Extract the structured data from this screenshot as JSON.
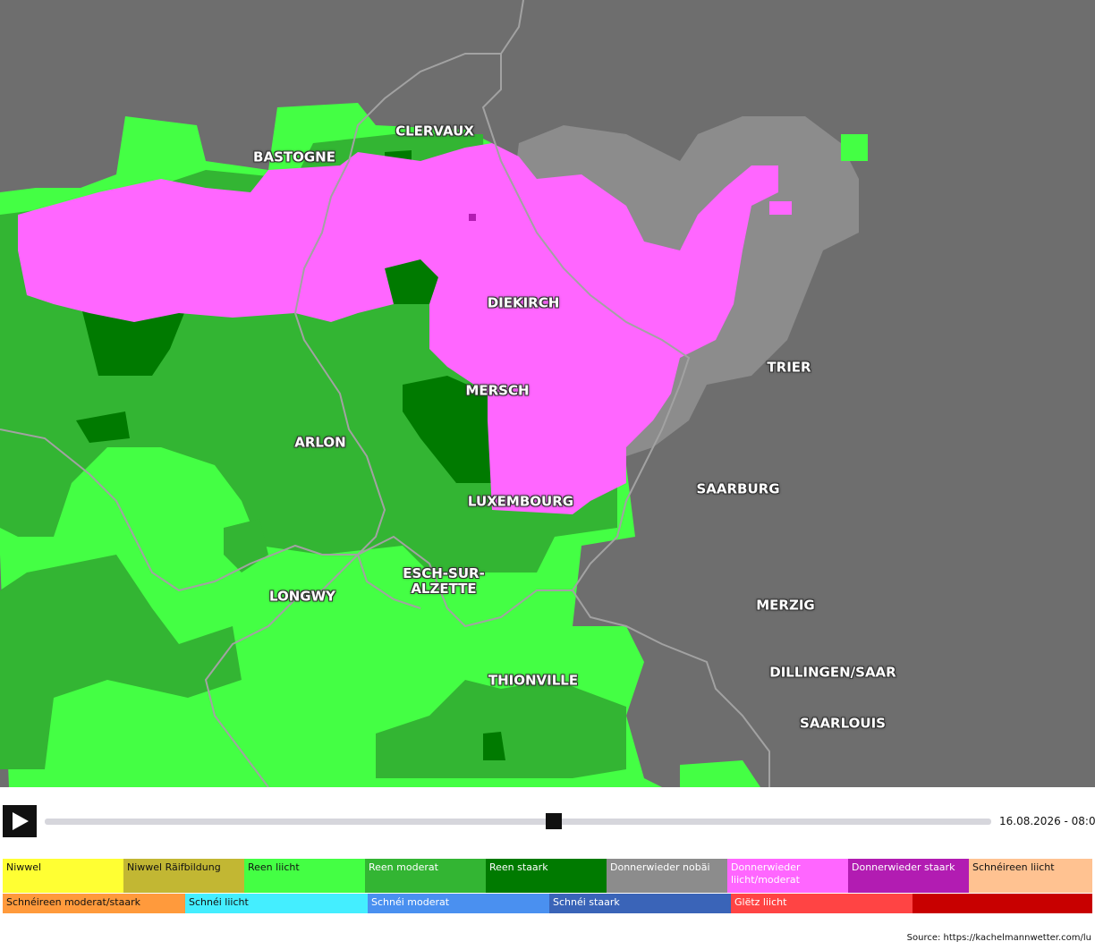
{
  "map": {
    "cities": [
      {
        "name": "BASTOGNE"
      },
      {
        "name": "CLERVAUX"
      },
      {
        "name": "DIEKIRCH"
      },
      {
        "name": "TRIER"
      },
      {
        "name": "MERSCH"
      },
      {
        "name": "ARLON"
      },
      {
        "name": "SAARBURG"
      },
      {
        "name": "LUXEMBOURG"
      },
      {
        "name": "ESCH-SUR-\nALZETTE"
      },
      {
        "name": "LONGWY"
      },
      {
        "name": "MERZIG"
      },
      {
        "name": "DILLINGEN/SAAR"
      },
      {
        "name": "THIONVILLE"
      },
      {
        "name": "SAARLOUIS"
      }
    ],
    "colors": {
      "background": "#6e6e6e",
      "border": "#9a9a9a",
      "rain_light": "#44ff44",
      "rain_moderate": "#33b533",
      "rain_heavy": "#007a00",
      "thunder_possible": "#8c8c8c",
      "thunder_light_moderate": "#ff66ff",
      "thunder_heavy": "#b21cb2"
    }
  },
  "player": {
    "play_icon": "play-icon",
    "timestamp": "16.08.2026 - 08:00",
    "progress": 0.538
  },
  "legend": {
    "row1": [
      {
        "label": "Niwwel",
        "color": "#ffff33"
      },
      {
        "label": "Niwwel Räifbildung",
        "color": "#c2b733"
      },
      {
        "label": "Reen liicht",
        "color": "#44ff44"
      },
      {
        "label": "Reen moderat",
        "color": "#33b533"
      },
      {
        "label": "Reen staark",
        "color": "#007a00"
      },
      {
        "label": "Donnerwieder nobäi",
        "color": "#8c8c8c"
      },
      {
        "label": "Donnerwieder liicht/moderat",
        "color": "#ff66ff"
      },
      {
        "label": "Donnerwieder staark",
        "color": "#b21cb2"
      },
      {
        "label": "Schnéireen liicht",
        "color": "#ffc291"
      }
    ],
    "row2": [
      {
        "label": "Schnéireen moderat/staark",
        "color": "#ff9a3c"
      },
      {
        "label": "Schnéi liicht",
        "color": "#44eeff"
      },
      {
        "label": "Schnéi moderat",
        "color": "#4a90f0"
      },
      {
        "label": "Schnéi staark",
        "color": "#3a64b8"
      },
      {
        "label": "Glëtz liicht",
        "color": "#ff4444"
      },
      {
        "label": "",
        "color": "#c80000"
      }
    ]
  },
  "source": "Source: https://kachelmannwetter.com/lu"
}
